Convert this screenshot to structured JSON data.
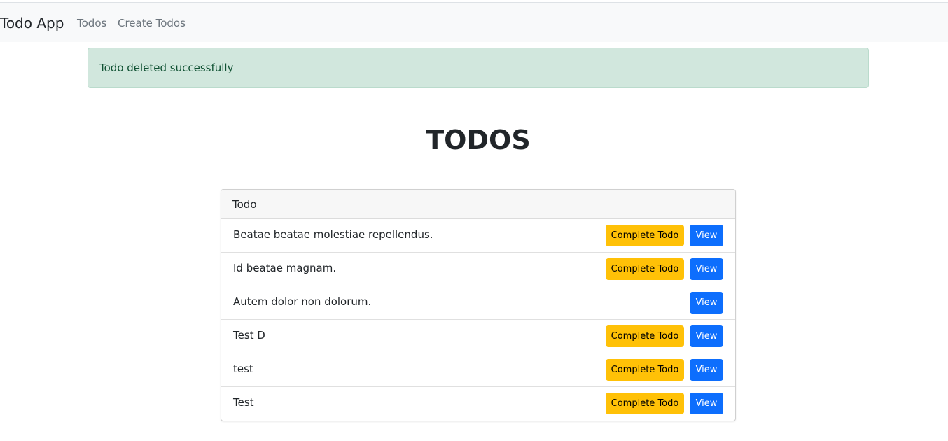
{
  "navbar": {
    "brand": "Todo App",
    "links": [
      "Todos",
      "Create Todos"
    ]
  },
  "alert": {
    "message": "Todo deleted successfully"
  },
  "page_title": "TODOS",
  "table": {
    "header": "Todo",
    "complete_label": "Complete Todo",
    "view_label": "View",
    "rows": [
      {
        "text": "Beatae beatae molestiae repellendus.",
        "show_complete": true
      },
      {
        "text": "Id beatae magnam.",
        "show_complete": true
      },
      {
        "text": "Autem dolor non dolorum.",
        "show_complete": false
      },
      {
        "text": "Test D",
        "show_complete": true
      },
      {
        "text": "test",
        "show_complete": true
      },
      {
        "text": "Test",
        "show_complete": true
      }
    ]
  },
  "colors": {
    "navbar_bg": "#f8f9fa",
    "alert_bg": "#d1e7dd",
    "alert_text": "#0f5132",
    "complete_button": "#ffc107",
    "view_button": "#0d6efd"
  }
}
